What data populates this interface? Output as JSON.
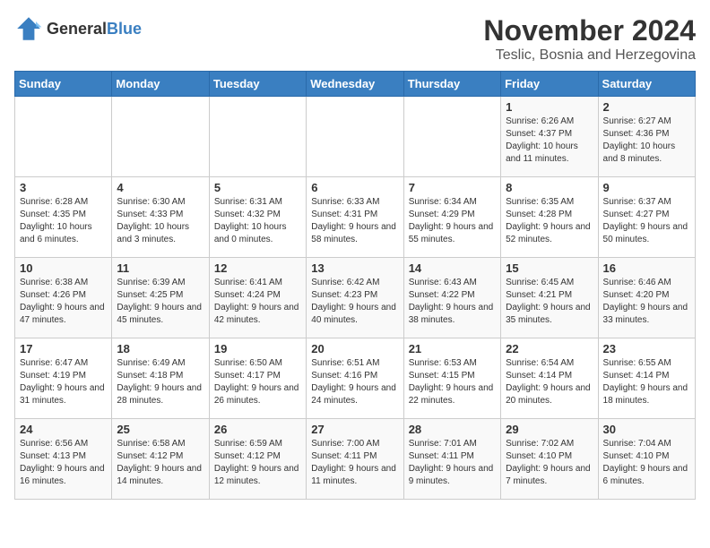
{
  "logo": {
    "general": "General",
    "blue": "Blue"
  },
  "title": "November 2024",
  "subtitle": "Teslic, Bosnia and Herzegovina",
  "days_of_week": [
    "Sunday",
    "Monday",
    "Tuesday",
    "Wednesday",
    "Thursday",
    "Friday",
    "Saturday"
  ],
  "weeks": [
    [
      {
        "day": "",
        "info": ""
      },
      {
        "day": "",
        "info": ""
      },
      {
        "day": "",
        "info": ""
      },
      {
        "day": "",
        "info": ""
      },
      {
        "day": "",
        "info": ""
      },
      {
        "day": "1",
        "info": "Sunrise: 6:26 AM\nSunset: 4:37 PM\nDaylight: 10 hours and 11 minutes."
      },
      {
        "day": "2",
        "info": "Sunrise: 6:27 AM\nSunset: 4:36 PM\nDaylight: 10 hours and 8 minutes."
      }
    ],
    [
      {
        "day": "3",
        "info": "Sunrise: 6:28 AM\nSunset: 4:35 PM\nDaylight: 10 hours and 6 minutes."
      },
      {
        "day": "4",
        "info": "Sunrise: 6:30 AM\nSunset: 4:33 PM\nDaylight: 10 hours and 3 minutes."
      },
      {
        "day": "5",
        "info": "Sunrise: 6:31 AM\nSunset: 4:32 PM\nDaylight: 10 hours and 0 minutes."
      },
      {
        "day": "6",
        "info": "Sunrise: 6:33 AM\nSunset: 4:31 PM\nDaylight: 9 hours and 58 minutes."
      },
      {
        "day": "7",
        "info": "Sunrise: 6:34 AM\nSunset: 4:29 PM\nDaylight: 9 hours and 55 minutes."
      },
      {
        "day": "8",
        "info": "Sunrise: 6:35 AM\nSunset: 4:28 PM\nDaylight: 9 hours and 52 minutes."
      },
      {
        "day": "9",
        "info": "Sunrise: 6:37 AM\nSunset: 4:27 PM\nDaylight: 9 hours and 50 minutes."
      }
    ],
    [
      {
        "day": "10",
        "info": "Sunrise: 6:38 AM\nSunset: 4:26 PM\nDaylight: 9 hours and 47 minutes."
      },
      {
        "day": "11",
        "info": "Sunrise: 6:39 AM\nSunset: 4:25 PM\nDaylight: 9 hours and 45 minutes."
      },
      {
        "day": "12",
        "info": "Sunrise: 6:41 AM\nSunset: 4:24 PM\nDaylight: 9 hours and 42 minutes."
      },
      {
        "day": "13",
        "info": "Sunrise: 6:42 AM\nSunset: 4:23 PM\nDaylight: 9 hours and 40 minutes."
      },
      {
        "day": "14",
        "info": "Sunrise: 6:43 AM\nSunset: 4:22 PM\nDaylight: 9 hours and 38 minutes."
      },
      {
        "day": "15",
        "info": "Sunrise: 6:45 AM\nSunset: 4:21 PM\nDaylight: 9 hours and 35 minutes."
      },
      {
        "day": "16",
        "info": "Sunrise: 6:46 AM\nSunset: 4:20 PM\nDaylight: 9 hours and 33 minutes."
      }
    ],
    [
      {
        "day": "17",
        "info": "Sunrise: 6:47 AM\nSunset: 4:19 PM\nDaylight: 9 hours and 31 minutes."
      },
      {
        "day": "18",
        "info": "Sunrise: 6:49 AM\nSunset: 4:18 PM\nDaylight: 9 hours and 28 minutes."
      },
      {
        "day": "19",
        "info": "Sunrise: 6:50 AM\nSunset: 4:17 PM\nDaylight: 9 hours and 26 minutes."
      },
      {
        "day": "20",
        "info": "Sunrise: 6:51 AM\nSunset: 4:16 PM\nDaylight: 9 hours and 24 minutes."
      },
      {
        "day": "21",
        "info": "Sunrise: 6:53 AM\nSunset: 4:15 PM\nDaylight: 9 hours and 22 minutes."
      },
      {
        "day": "22",
        "info": "Sunrise: 6:54 AM\nSunset: 4:14 PM\nDaylight: 9 hours and 20 minutes."
      },
      {
        "day": "23",
        "info": "Sunrise: 6:55 AM\nSunset: 4:14 PM\nDaylight: 9 hours and 18 minutes."
      }
    ],
    [
      {
        "day": "24",
        "info": "Sunrise: 6:56 AM\nSunset: 4:13 PM\nDaylight: 9 hours and 16 minutes."
      },
      {
        "day": "25",
        "info": "Sunrise: 6:58 AM\nSunset: 4:12 PM\nDaylight: 9 hours and 14 minutes."
      },
      {
        "day": "26",
        "info": "Sunrise: 6:59 AM\nSunset: 4:12 PM\nDaylight: 9 hours and 12 minutes."
      },
      {
        "day": "27",
        "info": "Sunrise: 7:00 AM\nSunset: 4:11 PM\nDaylight: 9 hours and 11 minutes."
      },
      {
        "day": "28",
        "info": "Sunrise: 7:01 AM\nSunset: 4:11 PM\nDaylight: 9 hours and 9 minutes."
      },
      {
        "day": "29",
        "info": "Sunrise: 7:02 AM\nSunset: 4:10 PM\nDaylight: 9 hours and 7 minutes."
      },
      {
        "day": "30",
        "info": "Sunrise: 7:04 AM\nSunset: 4:10 PM\nDaylight: 9 hours and 6 minutes."
      }
    ]
  ]
}
